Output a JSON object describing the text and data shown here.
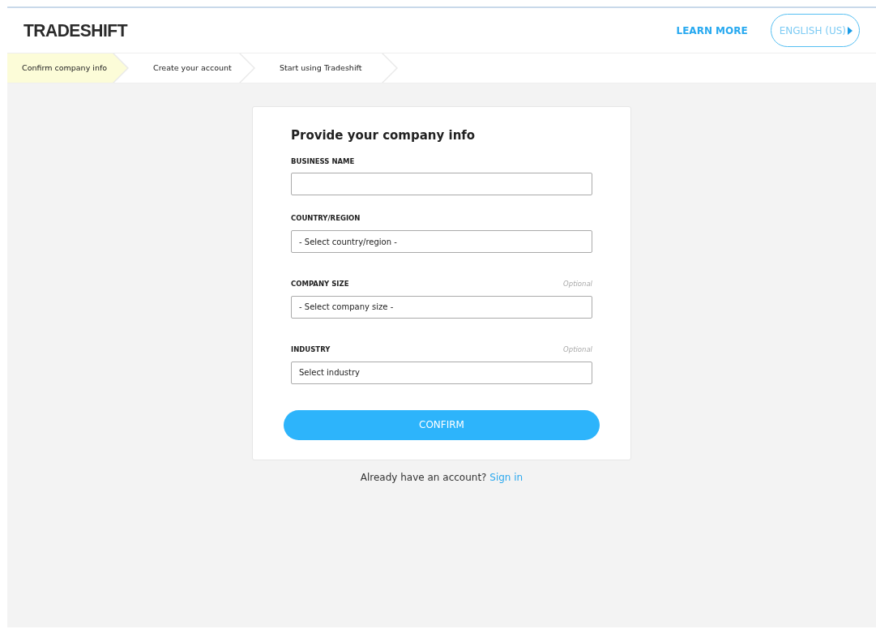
{
  "header": {
    "logo": "TRADESHIFT",
    "learn_more": "LEARN MORE",
    "language": "ENGLISH (US)"
  },
  "steps": [
    {
      "label": "Confirm company info",
      "selected": true
    },
    {
      "label": "Create your account",
      "selected": false
    },
    {
      "label": "Start using Tradeshift",
      "selected": false
    }
  ],
  "form": {
    "title": "Provide your company info",
    "fields": [
      {
        "label": "BUSINESS NAME"
      },
      {
        "label": "COUNTRY/REGION",
        "value": "- Select country/region -"
      },
      {
        "label": "COMPANY SIZE",
        "optional": "Optional",
        "value": "- Select company size -"
      },
      {
        "label": "INDUSTRY",
        "optional": "Optional",
        "value": "Select industry"
      }
    ],
    "submit": "CONFIRM"
  },
  "footer": {
    "text": "Already have an account?",
    "link": "Sign in"
  }
}
